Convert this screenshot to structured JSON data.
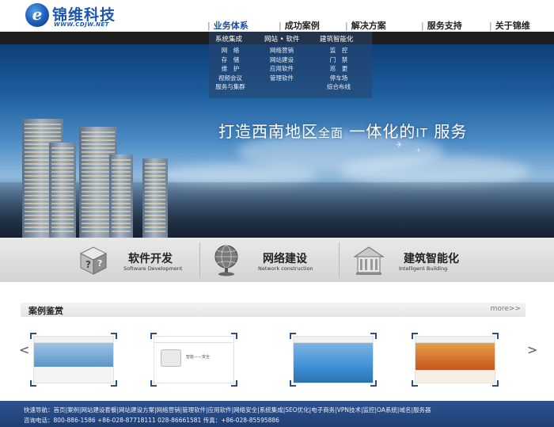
{
  "header": {
    "logo_mark": "e",
    "logo_name": "锦维科技",
    "logo_url": "WWW.CDJW.NET",
    "nav": [
      {
        "label": "业务体系"
      },
      {
        "label": "成功案例"
      },
      {
        "label": "解决方案"
      },
      {
        "label": "服务支持"
      },
      {
        "label": "关于锦维"
      }
    ],
    "nav_separator": "|"
  },
  "dropdown": {
    "heads": [
      "系统集成",
      "网站 • 软件",
      "建筑智能化"
    ],
    "columns": [
      [
        "网　络",
        "存　储",
        "维　护",
        "视频会议",
        "服务与集群"
      ],
      [
        "网络营销",
        "网站建设",
        "应用软件",
        "管理软件"
      ],
      [
        "监　控",
        "门　禁",
        "巡　更",
        "停车场",
        "综合布线"
      ]
    ]
  },
  "banner": {
    "slogan_a": "打造西南地区",
    "slogan_b": "全面",
    "slogan_c": "一体化的",
    "slogan_d": "IT",
    "slogan_e": "服务",
    "plane_icon": "airplane-icon",
    "slide_count": 3,
    "active_slide": 2
  },
  "services": [
    {
      "title": "软件开发",
      "subtitle": "Software Development",
      "icon": "software-box-icon"
    },
    {
      "title": "网络建设",
      "subtitle": "Network construction",
      "icon": "globe-icon"
    },
    {
      "title": "建筑智能化",
      "subtitle": "Intelligent Building",
      "icon": "building-icon"
    }
  ],
  "cases": {
    "title": "案例鉴赏",
    "more": "more>>",
    "prev": "<",
    "next": ">",
    "thumbs": [
      {
        "caption": "",
        "accent": "#4a86c8"
      },
      {
        "caption": "智能——安全",
        "accent": "#d9d9d9"
      },
      {
        "caption": "",
        "accent": "#3b8fd6"
      },
      {
        "caption": "",
        "accent": "#c9541e"
      }
    ]
  },
  "footer": {
    "line1": "快速导航：首页|案例|网站建设套餐|网站建设方案|网络营销|管理软件|应用软件|网络安全|系统集成|SEO优化|电子商务|VPN技术|监控|OA系统|域名|服务器",
    "line2": "咨询电话：800-886-1586 +86-028-87718111 028-86661581 传真：+86-028-85595886"
  },
  "colors": {
    "brand": "#1d56b0",
    "footer": "#2d5391",
    "strip": "#1f1f1f"
  }
}
